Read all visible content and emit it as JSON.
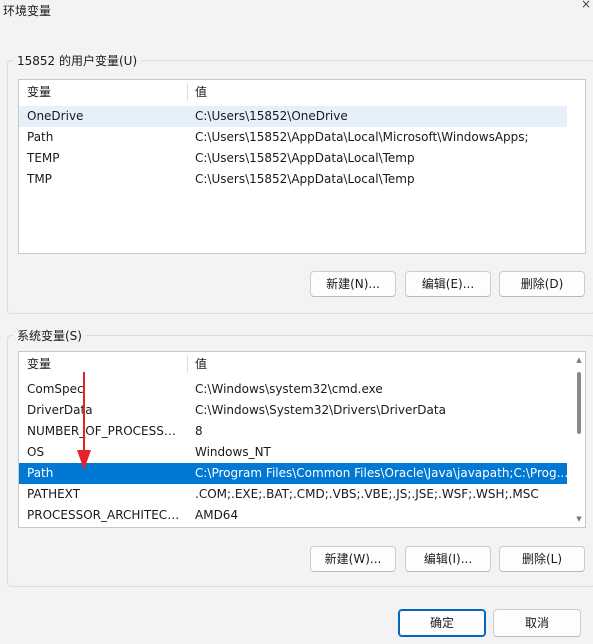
{
  "window": {
    "title": "环境变量",
    "close_glyph": "×"
  },
  "user_vars": {
    "label": "15852 的用户变量(U)",
    "headers": {
      "name": "变量",
      "value": "值"
    },
    "rows": [
      {
        "name": "OneDrive",
        "value": "C:\\Users\\15852\\OneDrive"
      },
      {
        "name": "Path",
        "value": "C:\\Users\\15852\\AppData\\Local\\Microsoft\\WindowsApps;"
      },
      {
        "name": "TEMP",
        "value": "C:\\Users\\15852\\AppData\\Local\\Temp"
      },
      {
        "name": "TMP",
        "value": "C:\\Users\\15852\\AppData\\Local\\Temp"
      }
    ],
    "buttons": {
      "new": "新建(N)...",
      "edit": "编辑(E)...",
      "delete": "删除(D)"
    }
  },
  "system_vars": {
    "label": "系统变量(S)",
    "headers": {
      "name": "变量",
      "value": "值"
    },
    "rows": [
      {
        "name": "ComSpec",
        "value": "C:\\Windows\\system32\\cmd.exe"
      },
      {
        "name": "DriverData",
        "value": "C:\\Windows\\System32\\Drivers\\DriverData"
      },
      {
        "name": "NUMBER_OF_PROCESSORS",
        "value": "8"
      },
      {
        "name": "OS",
        "value": "Windows_NT"
      },
      {
        "name": "Path",
        "value": "C:\\Program Files\\Common Files\\Oracle\\Java\\javapath;C:\\Prog..."
      },
      {
        "name": "PATHEXT",
        "value": ".COM;.EXE;.BAT;.CMD;.VBS;.VBE;.JS;.JSE;.WSF;.WSH;.MSC"
      },
      {
        "name": "PROCESSOR_ARCHITECT...",
        "value": "AMD64"
      }
    ],
    "buttons": {
      "new": "新建(W)...",
      "edit": "编辑(I)...",
      "delete": "删除(L)"
    }
  },
  "dialog_buttons": {
    "ok": "确定",
    "cancel": "取消"
  },
  "colors": {
    "selection": "#0078d4",
    "annotation_arrow": "#e8202a",
    "hover": "#e5f0fb"
  }
}
